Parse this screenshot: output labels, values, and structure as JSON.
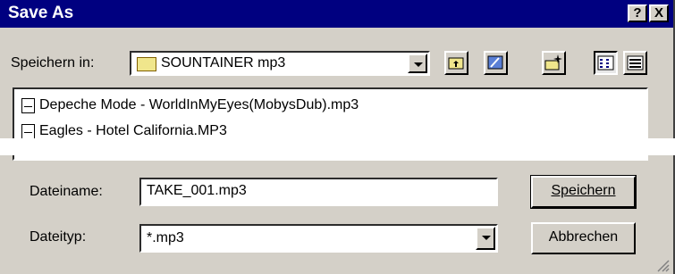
{
  "window": {
    "title": "Save As",
    "help_label": "?",
    "close_label": "X"
  },
  "location": {
    "label": "Speichern in:",
    "current_folder": "SOUNTAINER mp3"
  },
  "toolbar": {
    "icons": [
      "up-folder-icon",
      "desktop-icon",
      "new-folder-icon",
      "list-view-icon",
      "details-view-icon"
    ]
  },
  "files": [
    {
      "name": "Depeche Mode - WorldInMyEyes(MobysDub).mp3"
    },
    {
      "name": "Eagles - Hotel California.MP3"
    }
  ],
  "filename": {
    "label": "Dateiname:",
    "value": "TAKE_001.mp3"
  },
  "filetype": {
    "label": "Dateityp:",
    "value": "*.mp3"
  },
  "buttons": {
    "save_label": "Speichern",
    "cancel_label": "Abbrechen"
  },
  "colors": {
    "titlebar": "#000080",
    "face": "#d4d0c8"
  }
}
